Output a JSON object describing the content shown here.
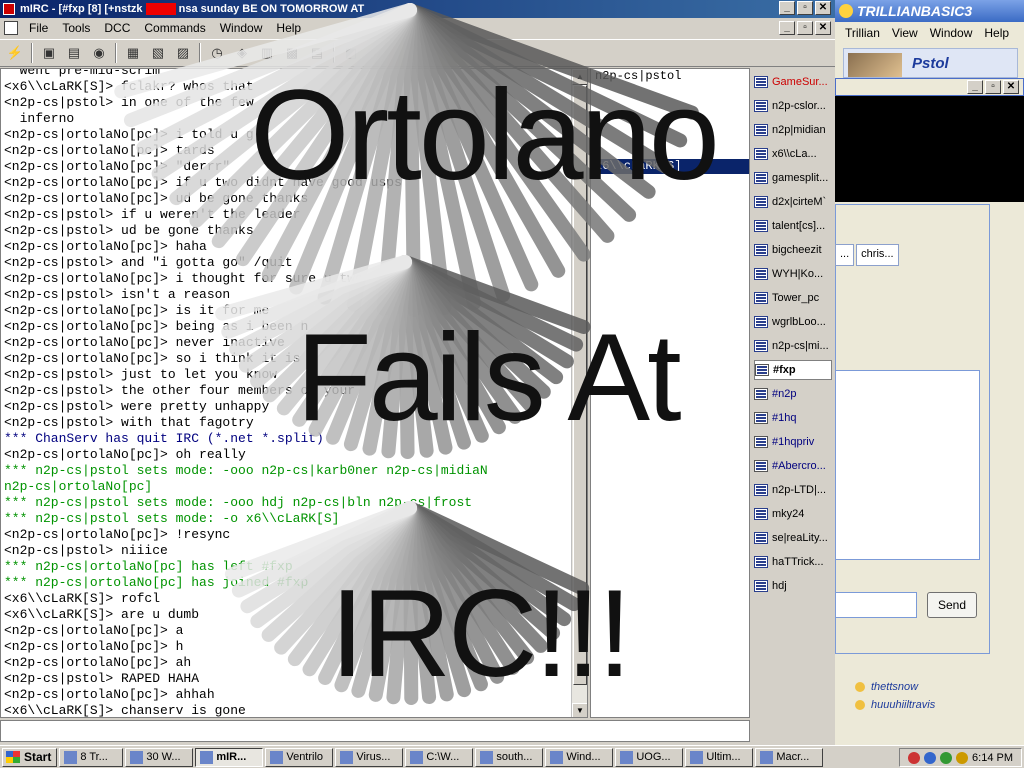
{
  "mirc": {
    "title_prefix": "mIRC - [#fxp [8] [+nstzk",
    "title_suffix": "nsa sunday BE ON TOMORROW AT",
    "menu": [
      "File",
      "Tools",
      "DCC",
      "Commands",
      "Window",
      "Help"
    ],
    "chat_lines": [
      {
        "text": "  went pre-mid-scrim",
        "c": ""
      },
      {
        "text": "<x6\\\\cLaRK[S]> fclakr? whos that",
        "c": ""
      },
      {
        "text": "<n2p-cs|pstol> in one of the few",
        "c": ""
      },
      {
        "text": "  inferno",
        "c": ""
      },
      {
        "text": "<n2p-cs|ortolaNo[pc]> i told u g",
        "c": ""
      },
      {
        "text": "<n2p-cs|ortolaNo[pc]> tards",
        "c": ""
      },
      {
        "text": "<n2p-cs|ortolaNo[pc]> \"derrr\"",
        "c": ""
      },
      {
        "text": "<n2p-cs|ortolaNo[pc]> if u two didnt have good usps",
        "c": ""
      },
      {
        "text": "<n2p-cs|ortolaNo[pc]> ud be gone thanks",
        "c": ""
      },
      {
        "text": "<n2p-cs|pstol> if u weren't the leader",
        "c": ""
      },
      {
        "text": "<n2p-cs|pstol> ud be gone thanks",
        "c": ""
      },
      {
        "text": "<n2p-cs|ortolaNo[pc]> haha",
        "c": ""
      },
      {
        "text": "<n2p-cs|pstol> and \"i gotta go\" /quit",
        "c": ""
      },
      {
        "text": "<n2p-cs|ortolaNo[pc]> i thought for sure u two",
        "c": ""
      },
      {
        "text": "<n2p-cs|pstol> isn't a reason",
        "c": ""
      },
      {
        "text": "<n2p-cs|ortolaNo[pc]> is it for me",
        "c": ""
      },
      {
        "text": "<n2p-cs|ortolaNo[pc]> being as i been h",
        "c": ""
      },
      {
        "text": "<n2p-cs|ortolaNo[pc]> never inactive",
        "c": ""
      },
      {
        "text": "<n2p-cs|ortolaNo[pc]> so i think it is",
        "c": ""
      },
      {
        "text": "<n2p-cs|pstol> just to let you know",
        "c": ""
      },
      {
        "text": "<n2p-cs|pstol> the other four members of your",
        "c": ""
      },
      {
        "text": "<n2p-cs|pstol> were pretty unhappy",
        "c": ""
      },
      {
        "text": "<n2p-cs|pstol> with that fagotry",
        "c": ""
      },
      {
        "text": "*** ChanServ has quit IRC (*.net *.split)",
        "c": "b"
      },
      {
        "text": "<n2p-cs|ortolaNo[pc]> oh really",
        "c": ""
      },
      {
        "text": "*** n2p-cs|pstol sets mode: -ooo n2p-cs|karb0ner n2p-cs|midiaN",
        "c": "g"
      },
      {
        "text": "n2p-cs|ortolaNo[pc]",
        "c": "g"
      },
      {
        "text": "*** n2p-cs|pstol sets mode: -ooo hdj n2p-cs|bln n2p-cs|frost",
        "c": "g"
      },
      {
        "text": "*** n2p-cs|pstol sets mode: -o x6\\\\cLaRK[S]",
        "c": "g"
      },
      {
        "text": "<n2p-cs|ortolaNo[pc]> !resync",
        "c": ""
      },
      {
        "text": "<n2p-cs|pstol> niiice",
        "c": ""
      },
      {
        "text": "*** n2p-cs|ortolaNo[pc] has left #fxp",
        "c": "g"
      },
      {
        "text": "*** n2p-cs|ortolaNo[pc] has joined #fxp",
        "c": "g"
      },
      {
        "text": "<x6\\\\cLaRK[S]> rofcl",
        "c": ""
      },
      {
        "text": "<x6\\\\cLaRK[S]> are u dumb",
        "c": ""
      },
      {
        "text": "<n2p-cs|ortolaNo[pc]> a",
        "c": ""
      },
      {
        "text": "<n2p-cs|ortolaNo[pc]> h",
        "c": ""
      },
      {
        "text": "<n2p-cs|ortolaNo[pc]> ah",
        "c": ""
      },
      {
        "text": "<n2p-cs|pstol> RAPED HAHA",
        "c": ""
      },
      {
        "text": "<n2p-cs|ortolaNo[pc]> ahhah",
        "c": ""
      },
      {
        "text": "<x6\\\\cLaRK[S]> chanserv is gone",
        "c": ""
      }
    ],
    "nicklist": [
      {
        "name": "n2p-cs|pstol",
        "selected": false
      },
      {
        "name": "",
        "selected": false
      },
      {
        "name": "",
        "selected": false
      },
      {
        "name": "",
        "selected": false
      },
      {
        "name": "",
        "selected": false
      },
      {
        "name": "",
        "selected": false
      },
      {
        "name": "x6\\\\cLaRK[S]",
        "selected": true
      }
    ],
    "switchbar": [
      {
        "label": "GameSur...",
        "style": "red",
        "hash": false
      },
      {
        "label": "n2p-cslor...",
        "style": "",
        "hash": false
      },
      {
        "label": "n2p|midian",
        "style": "",
        "hash": false
      },
      {
        "label": "x6\\\\cLa...",
        "style": "",
        "hash": false
      },
      {
        "label": "gamesplit...",
        "style": "",
        "hash": false
      },
      {
        "label": "d2x|cirteM`",
        "style": "",
        "hash": false
      },
      {
        "label": "talent[cs]...",
        "style": "",
        "hash": false
      },
      {
        "label": "bigcheezit",
        "style": "",
        "hash": false
      },
      {
        "label": "WYH|Ko...",
        "style": "",
        "hash": false
      },
      {
        "label": "Tower_pc",
        "style": "",
        "hash": false
      },
      {
        "label": "wgrlbLoo...",
        "style": "",
        "hash": false
      },
      {
        "label": "n2p-cs|mi...",
        "style": "",
        "hash": false
      },
      {
        "label": "#fxp",
        "style": "active",
        "hash": true
      },
      {
        "label": "#n2p",
        "style": "blue",
        "hash": true
      },
      {
        "label": "#1hq",
        "style": "blue",
        "hash": true
      },
      {
        "label": "#1hqpriv",
        "style": "blue",
        "hash": true
      },
      {
        "label": "#Abercro...",
        "style": "blue",
        "hash": true
      },
      {
        "label": "n2p-LTD|...",
        "style": "",
        "hash": false
      },
      {
        "label": "mky24",
        "style": "",
        "hash": false
      },
      {
        "label": "se|reaLity...",
        "style": "",
        "hash": false
      },
      {
        "label": "haTTrick...",
        "style": "",
        "hash": false
      },
      {
        "label": "hdj",
        "style": "",
        "hash": false
      }
    ]
  },
  "trillian": {
    "title": "TRILLIANBASIC3",
    "menu": [
      "Trillian",
      "View",
      "Window",
      "Help"
    ],
    "contact_name": "Pstol",
    "tab_left": "...",
    "tab_right": "chris...",
    "send_label": "Send",
    "buddies": [
      "thettsnow",
      "huuuhiiltravis"
    ]
  },
  "taskbar": {
    "start_label": "Start",
    "tasks": [
      {
        "label": "8 Tr...",
        "pressed": false
      },
      {
        "label": "30 W...",
        "pressed": false
      },
      {
        "label": "mIR...",
        "pressed": true
      },
      {
        "label": "Ventrilo",
        "pressed": false
      },
      {
        "label": "Virus...",
        "pressed": false
      },
      {
        "label": "C:\\W...",
        "pressed": false
      },
      {
        "label": "south...",
        "pressed": false
      },
      {
        "label": "Wind...",
        "pressed": false
      },
      {
        "label": "UOG...",
        "pressed": false
      },
      {
        "label": "Ultim...",
        "pressed": false
      },
      {
        "label": "Macr...",
        "pressed": false
      }
    ],
    "clock": "6:14 PM"
  },
  "overlay": {
    "line1": "Ortolano",
    "line2": "Fails At",
    "line3": "IRC!!!"
  }
}
